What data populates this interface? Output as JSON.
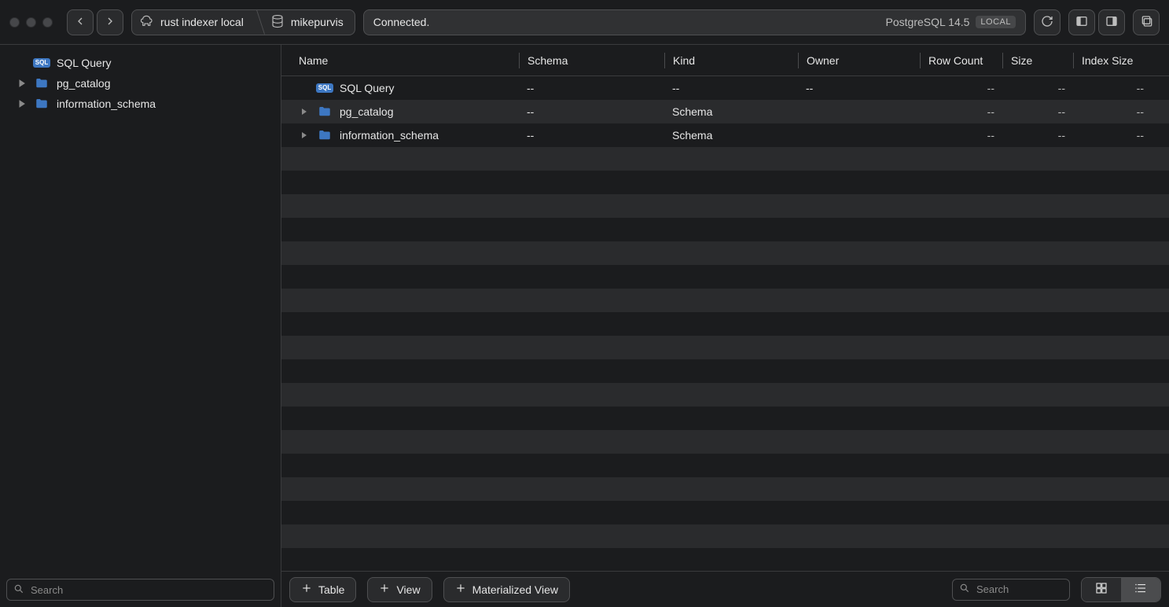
{
  "toolbar": {
    "breadcrumb": {
      "connection": "rust indexer local",
      "database": "mikepurvis"
    },
    "status": "Connected.",
    "server_version": "PostgreSQL 14.5",
    "server_badge": "LOCAL"
  },
  "sidebar": {
    "items": [
      {
        "label": "SQL Query",
        "type": "sql",
        "expandable": false
      },
      {
        "label": "pg_catalog",
        "type": "folder",
        "expandable": true
      },
      {
        "label": "information_schema",
        "type": "folder",
        "expandable": true
      }
    ],
    "search_placeholder": "Search"
  },
  "grid": {
    "columns": [
      "Name",
      "Schema",
      "Kind",
      "Owner",
      "Row Count",
      "Size",
      "Index Size"
    ],
    "rows": [
      {
        "name": "SQL Query",
        "type": "sql",
        "expandable": false,
        "schema": "--",
        "kind": "--",
        "owner": "--",
        "row_count": "--",
        "size": "--",
        "index_size": "--"
      },
      {
        "name": "pg_catalog",
        "type": "folder",
        "expandable": true,
        "schema": "--",
        "kind": "Schema",
        "owner": "",
        "row_count": "--",
        "size": "--",
        "index_size": "--"
      },
      {
        "name": "information_schema",
        "type": "folder",
        "expandable": true,
        "schema": "--",
        "kind": "Schema",
        "owner": "",
        "row_count": "--",
        "size": "--",
        "index_size": "--"
      }
    ],
    "empty_row_count": 17
  },
  "footer": {
    "add_table": "Table",
    "add_view": "View",
    "add_matview": "Materialized View",
    "search_placeholder": "Search"
  }
}
